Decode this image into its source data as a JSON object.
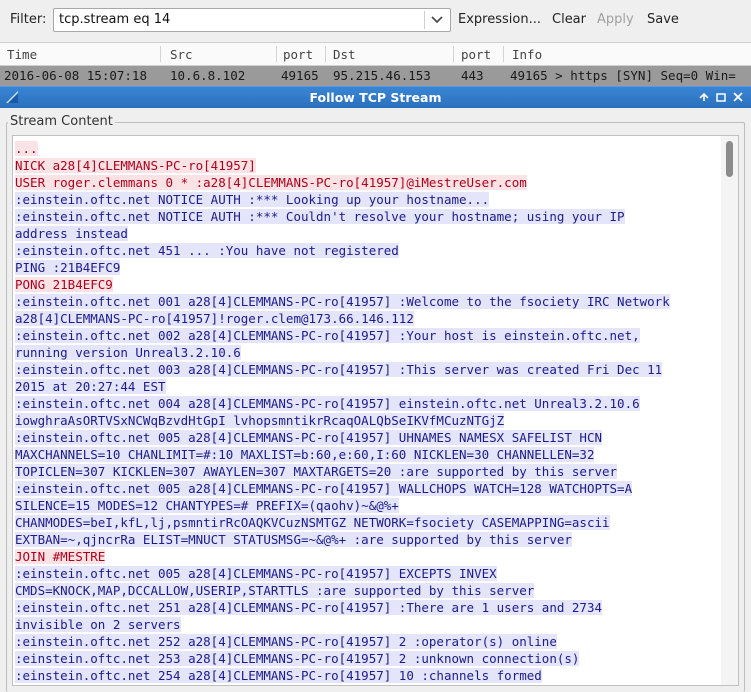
{
  "filter": {
    "label": "Filter:",
    "value": "tcp.stream eq 14",
    "buttons": {
      "expression": "Expression...",
      "clear": "Clear",
      "apply": "Apply",
      "save": "Save"
    }
  },
  "packet_list": {
    "columns": [
      "Time",
      "Src",
      "port",
      "Dst",
      "port",
      "Info"
    ],
    "row": {
      "time": "2016-06-08 15:07:18",
      "src": "10.6.8.102",
      "src_port": "49165",
      "dst": "95.215.46.153",
      "dst_port": "443",
      "info": "49165 > https [SYN] Seq=0 Win="
    }
  },
  "dialog": {
    "title": "Follow TCP Stream",
    "group_title": "Stream Content",
    "lines": [
      {
        "t": "...",
        "c": "client"
      },
      {
        "t": "NICK a28[4]CLEMMANS-PC-ro[41957]",
        "c": "client"
      },
      {
        "t": "USER roger.clemmans 0 * :a28[4]CLEMMANS-PC-ro[41957]@iMestreUser.com",
        "c": "client"
      },
      {
        "t": ":einstein.oftc.net NOTICE AUTH :*** Looking up your hostname...",
        "c": "server"
      },
      {
        "t": ":einstein.oftc.net NOTICE AUTH :*** Couldn't resolve your hostname; using your IP",
        "c": "server"
      },
      {
        "t": "address instead",
        "c": "server"
      },
      {
        "t": ":einstein.oftc.net 451 ... :You have not registered",
        "c": "server"
      },
      {
        "t": "PING :21B4EFC9",
        "c": "server"
      },
      {
        "t": "PONG 21B4EFC9",
        "c": "client"
      },
      {
        "t": ":einstein.oftc.net 001 a28[4]CLEMMANS-PC-ro[41957] :Welcome to the fsociety IRC Network",
        "c": "server"
      },
      {
        "t": "a28[4]CLEMMANS-PC-ro[41957]!roger.clem@173.66.146.112",
        "c": "server"
      },
      {
        "t": ":einstein.oftc.net 002 a28[4]CLEMMANS-PC-ro[41957] :Your host is einstein.oftc.net,",
        "c": "server"
      },
      {
        "t": "running version Unreal3.2.10.6",
        "c": "server"
      },
      {
        "t": ":einstein.oftc.net 003 a28[4]CLEMMANS-PC-ro[41957] :This server was created Fri Dec 11",
        "c": "server"
      },
      {
        "t": "2015 at 20:27:44 EST",
        "c": "server"
      },
      {
        "t": ":einstein.oftc.net 004 a28[4]CLEMMANS-PC-ro[41957] einstein.oftc.net Unreal3.2.10.6",
        "c": "server"
      },
      {
        "t": "iowghraAsORTVSxNCWqBzvdHtGpI lvhopsmntikrRcaqOALQbSeIKVfMCuzNTGjZ",
        "c": "server"
      },
      {
        "t": ":einstein.oftc.net 005 a28[4]CLEMMANS-PC-ro[41957] UHNAMES NAMESX SAFELIST HCN",
        "c": "server"
      },
      {
        "t": "MAXCHANNELS=10 CHANLIMIT=#:10 MAXLIST=b:60,e:60,I:60 NICKLEN=30 CHANNELLEN=32",
        "c": "server"
      },
      {
        "t": "TOPICLEN=307 KICKLEN=307 AWAYLEN=307 MAXTARGETS=20 :are supported by this server",
        "c": "server"
      },
      {
        "t": ":einstein.oftc.net 005 a28[4]CLEMMANS-PC-ro[41957] WALLCHOPS WATCH=128 WATCHOPTS=A",
        "c": "server"
      },
      {
        "t": "SILENCE=15 MODES=12 CHANTYPES=# PREFIX=(qaohv)~&@%+",
        "c": "server"
      },
      {
        "t": "CHANMODES=beI,kfL,lj,psmntirRcOAQKVCuzNSMTGZ NETWORK=fsociety CASEMAPPING=ascii",
        "c": "server"
      },
      {
        "t": "EXTBAN=~,qjncrRa ELIST=MNUCT STATUSMSG=~&@%+ :are supported by this server",
        "c": "server"
      },
      {
        "t": "JOIN #MESTRE",
        "c": "client"
      },
      {
        "t": ":einstein.oftc.net 005 a28[4]CLEMMANS-PC-ro[41957] EXCEPTS INVEX",
        "c": "server"
      },
      {
        "t": "CMDS=KNOCK,MAP,DCCALLOW,USERIP,STARTTLS :are supported by this server",
        "c": "server"
      },
      {
        "t": ":einstein.oftc.net 251 a28[4]CLEMMANS-PC-ro[41957] :There are 1 users and 2734",
        "c": "server"
      },
      {
        "t": "invisible on 2 servers",
        "c": "server"
      },
      {
        "t": ":einstein.oftc.net 252 a28[4]CLEMMANS-PC-ro[41957] 2 :operator(s) online",
        "c": "server"
      },
      {
        "t": ":einstein.oftc.net 253 a28[4]CLEMMANS-PC-ro[41957] 2 :unknown connection(s)",
        "c": "server"
      },
      {
        "t": ":einstein.oftc.net 254 a28[4]CLEMMANS-PC-ro[41957] 10 :channels formed",
        "c": "server"
      }
    ]
  },
  "colors": {
    "client_text": "#b0001b",
    "server_text": "#1c1c8c",
    "titlebar": "#2f78c6"
  }
}
